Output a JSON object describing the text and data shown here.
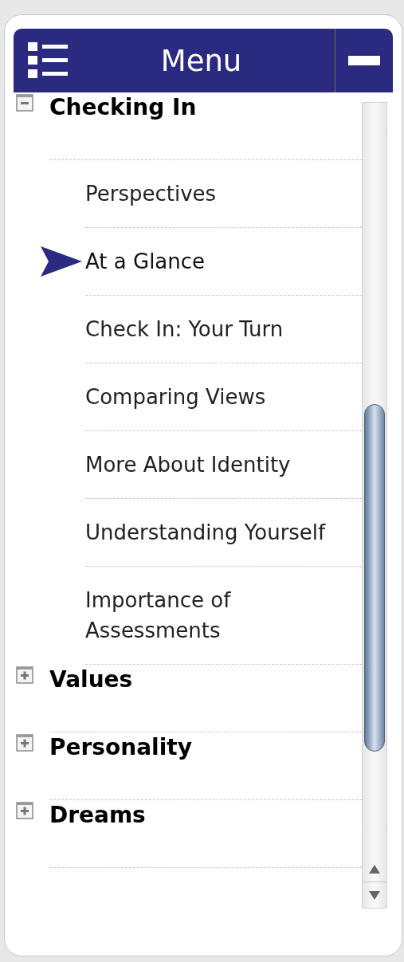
{
  "header": {
    "title": "Menu"
  },
  "sections": [
    {
      "label": "Checking In",
      "expanded": true,
      "items": [
        {
          "label": "Perspectives",
          "selected": false
        },
        {
          "label": "At a Glance",
          "selected": true
        },
        {
          "label": "Check In: Your Turn",
          "selected": false
        },
        {
          "label": "Comparing Views",
          "selected": false
        },
        {
          "label": "More About Identity",
          "selected": false
        },
        {
          "label": "Understanding Yourself",
          "selected": false
        },
        {
          "label": "Importance of Assessments",
          "selected": false
        }
      ]
    },
    {
      "label": "Values",
      "expanded": false
    },
    {
      "label": "Personality",
      "expanded": false
    },
    {
      "label": "Dreams",
      "expanded": false
    }
  ]
}
